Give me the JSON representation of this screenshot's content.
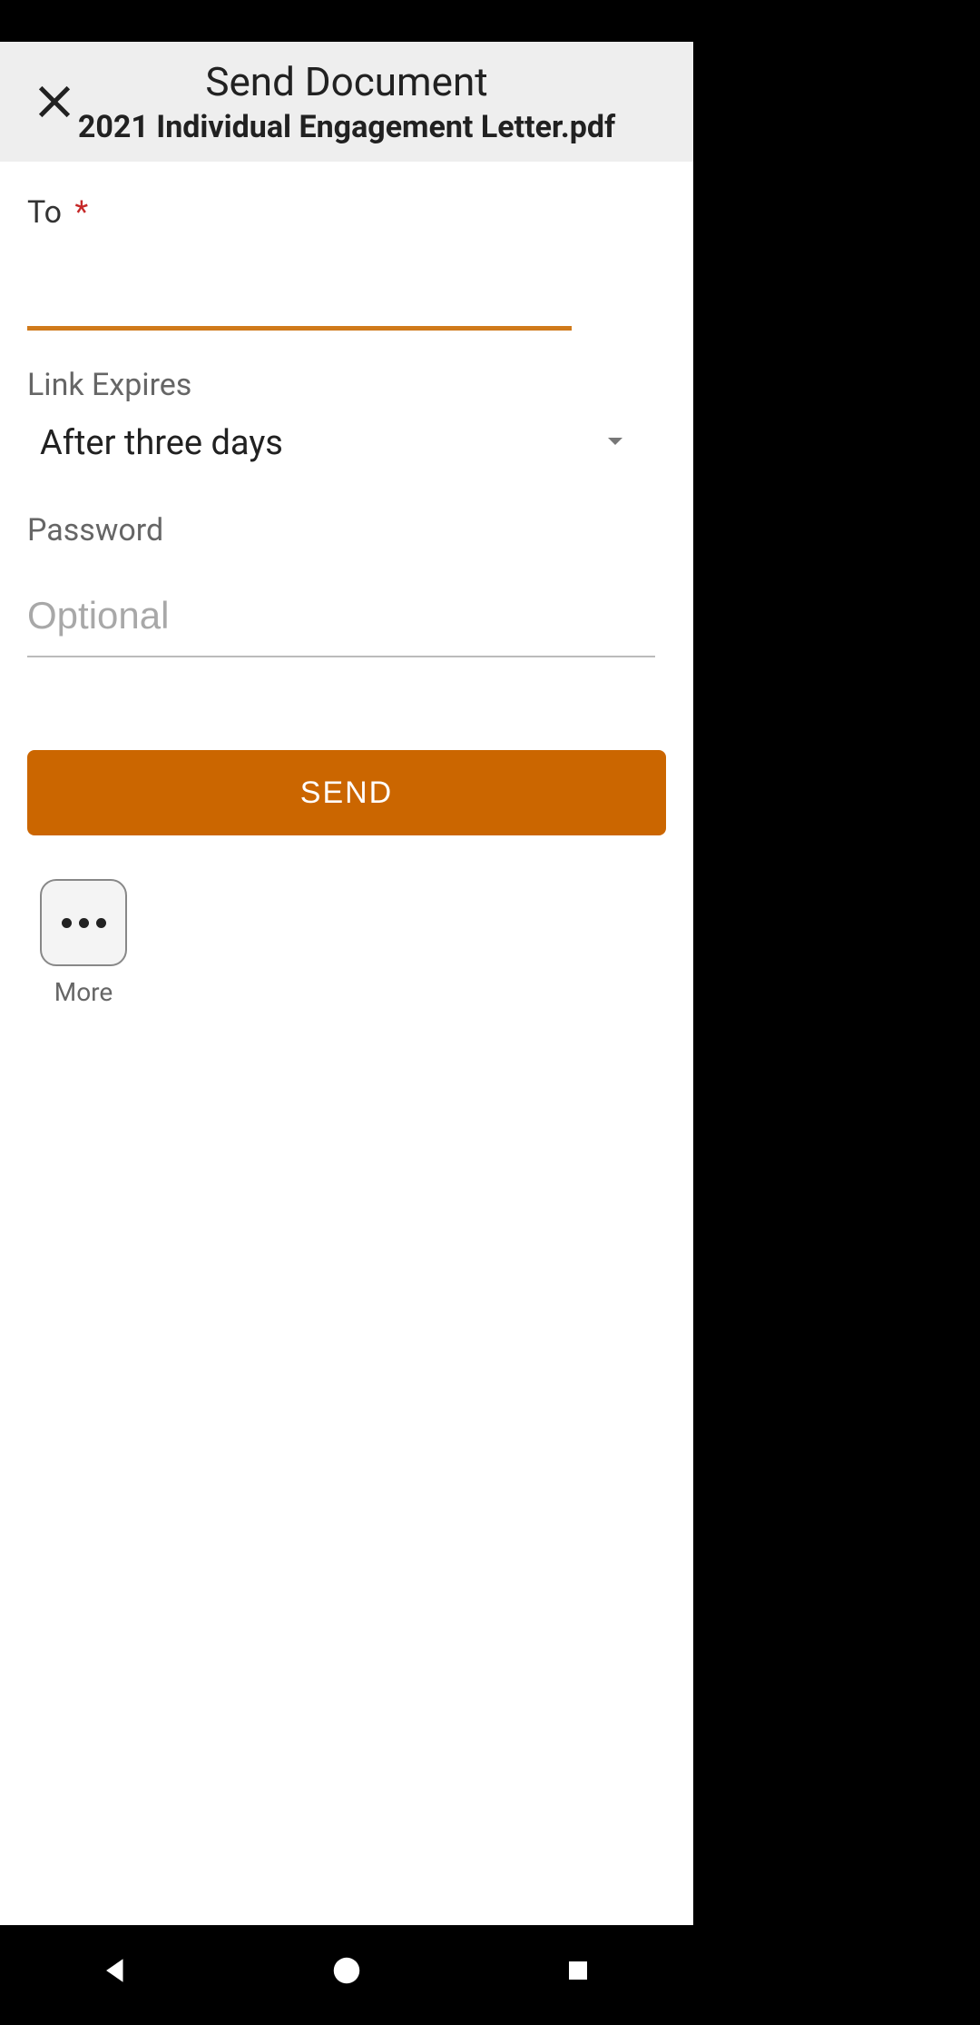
{
  "header": {
    "title": "Send Document",
    "subtitle": "2021 Individual Engagement Letter.pdf"
  },
  "form": {
    "to_label": "To",
    "to_required_mark": "*",
    "to_value": "",
    "link_expires_label": "Link Expires",
    "link_expires_value": "After three days",
    "password_label": "Password",
    "password_placeholder": "Optional",
    "password_value": "",
    "send_button_label": "SEND",
    "more_button_label": "More"
  },
  "icons": {
    "close": "close-icon",
    "dropdown": "chevron-down-icon",
    "more": "more-horizontal-icon",
    "nav_back": "triangle-back-icon",
    "nav_home": "circle-home-icon",
    "nav_recent": "square-recent-icon"
  },
  "colors": {
    "accent": "#cb6600",
    "input_underline_focused": "#d07a1b",
    "header_bg": "#eeeeee",
    "text_primary": "#212121",
    "text_secondary": "#666666"
  }
}
